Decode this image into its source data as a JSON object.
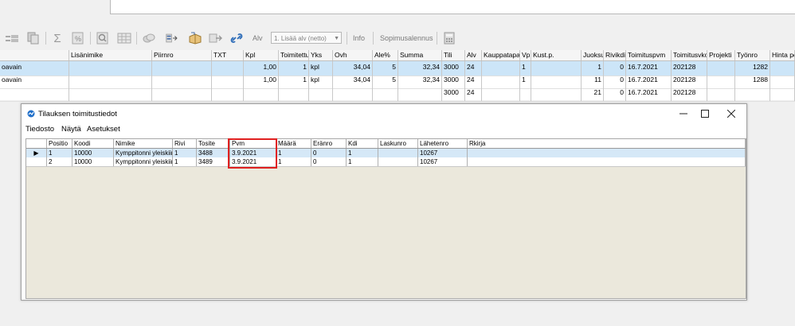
{
  "toolbar": {
    "alv_label": "Alv",
    "alv_select_value": "1. Lisää alv (netto)",
    "info_label": "Info",
    "discount_label": "Sopimusalennus"
  },
  "main_grid": {
    "columns": [
      "",
      "Lisänimike",
      "Piirnro",
      "TXT",
      "Kpl",
      "Toimitettu",
      "Yks",
      "Ovh",
      "Ale%",
      "Summa",
      "Tili",
      "Alv",
      "Kauppatapa",
      "Vp",
      "Kust.p.",
      "Juoksu",
      "Rivikdi",
      "Toimituspvm",
      "Toimitusvko",
      "Projekti",
      "Työnro",
      "Hinta pe"
    ],
    "rows": [
      [
        "oavain",
        "",
        "",
        "",
        "1,00",
        "1",
        "kpl",
        "34,04",
        "5",
        "32,34",
        "3000",
        "24",
        "",
        "1",
        "",
        "1",
        "0",
        "16.7.2021",
        "202128",
        "",
        "1282",
        ""
      ],
      [
        "oavain",
        "",
        "",
        "",
        "1,00",
        "1",
        "kpl",
        "34,04",
        "5",
        "32,34",
        "3000",
        "24",
        "",
        "1",
        "",
        "11",
        "0",
        "16.7.2021",
        "202128",
        "",
        "1288",
        ""
      ],
      [
        "",
        "",
        "",
        "",
        "",
        "",
        "",
        "",
        "",
        "",
        "3000",
        "24",
        "",
        "",
        "",
        "21",
        "0",
        "16.7.2021",
        "202128",
        "",
        "",
        ""
      ]
    ]
  },
  "dialog": {
    "title": "Tilauksen toimitustiedot",
    "menu": [
      "Tiedosto",
      "Näytä",
      "Asetukset"
    ],
    "columns": [
      "",
      "Positio",
      "Koodi",
      "Nimike",
      "Rivi",
      "Tosite",
      "Pvm",
      "Määrä",
      "Eränro",
      "Kdi",
      "Laskunro",
      "Lähetenro",
      "Rkirja"
    ],
    "rows": [
      [
        "▶",
        "1",
        "10000",
        "Kymppitonni yleiskiin",
        "1",
        "3488",
        "3.9.2021",
        "1",
        "0",
        "1",
        "",
        "10267",
        ""
      ],
      [
        "",
        "2",
        "10000",
        "Kymppitonni yleiskiin",
        "1",
        "3489",
        "3.9.2021",
        "1",
        "0",
        "1",
        "",
        "10267",
        ""
      ]
    ]
  },
  "colors": {
    "selected_row": "#cce5f8",
    "highlight_box": "#e02020",
    "dialog_grid_bg": "#ebe8dc"
  }
}
